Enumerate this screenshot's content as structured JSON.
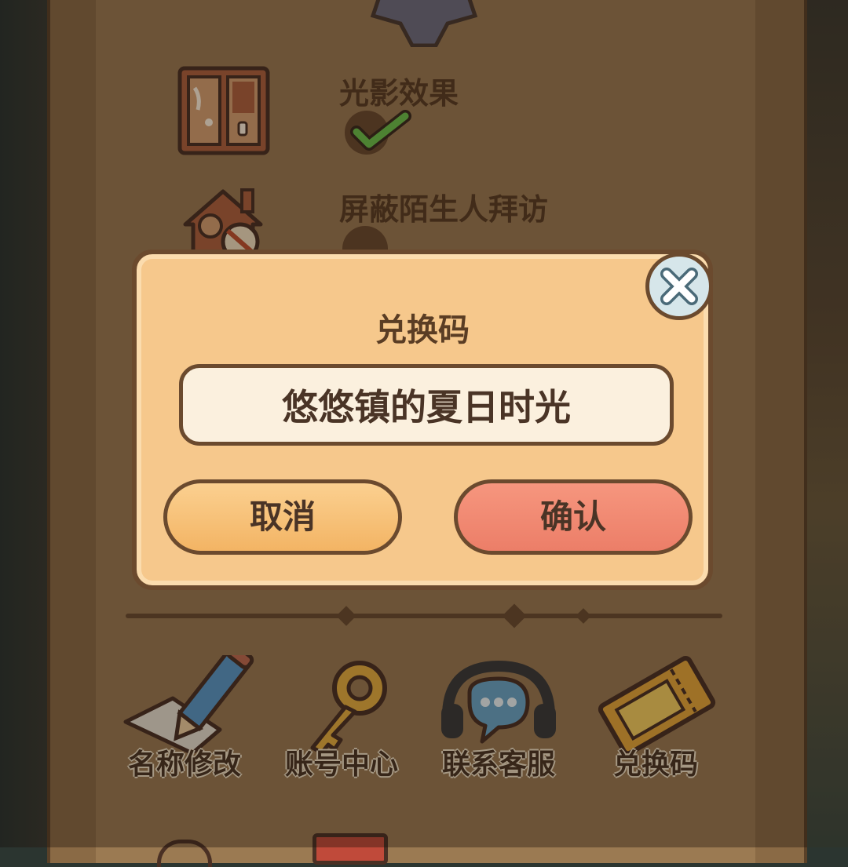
{
  "settings": {
    "lighting_label": "光影效果",
    "lighting_enabled": true,
    "block_visitors_label": "屏蔽陌生人拜访"
  },
  "menu": {
    "items": [
      {
        "label": "名称修改",
        "icon": "pencil-icon"
      },
      {
        "label": "账号中心",
        "icon": "key-icon"
      },
      {
        "label": "联系客服",
        "icon": "headset-icon"
      },
      {
        "label": "兑换码",
        "icon": "ticket-icon"
      }
    ]
  },
  "dialog": {
    "title": "兑换码",
    "input_value": "悠悠镇的夏日时光",
    "cancel_label": "取消",
    "confirm_label": "确认",
    "close_icon": "close-icon"
  },
  "colors": {
    "panel": "#8a6a45",
    "dialog_bg": "#f6c88c",
    "outline": "#6b4a2e",
    "cancel_button": "#f3b464",
    "confirm_button": "#ec7e68",
    "text": "#5a3d24"
  }
}
